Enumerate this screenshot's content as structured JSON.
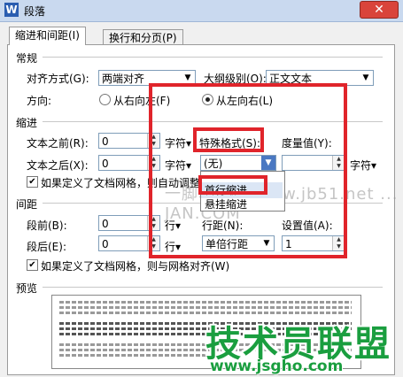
{
  "window": {
    "title": "段落",
    "app_icon": "W",
    "close_glyph": "✕"
  },
  "tabs": [
    {
      "label": "缩进和间距(I)",
      "active": true
    },
    {
      "label": "换行和分页(P)",
      "active": false
    }
  ],
  "general": {
    "heading": "常规",
    "alignment_label": "对齐方式(G):",
    "alignment_value": "两端对齐",
    "outline_label": "大纲级别(O):",
    "outline_value": "正文文本",
    "direction_label": "方向:",
    "rtl_label": "从右向左(F)",
    "ltr_label": "从左向右(L)"
  },
  "indent": {
    "heading": "缩进",
    "before_label": "文本之前(R):",
    "before_value": "0",
    "before_unit": "字符▾",
    "after_label": "文本之后(X):",
    "after_value": "0",
    "after_unit": "字符▾",
    "special_label": "特殊格式(S):",
    "special_value": "(无)",
    "measure_label": "度量值(Y):",
    "measure_value": "",
    "measure_unit": "字符▾",
    "grid_check_label": "如果定义了文档网格，则自动调整右缩进(D)",
    "dropdown_options": [
      "首行缩进",
      "悬挂缩进"
    ]
  },
  "spacing": {
    "heading": "间距",
    "before_label": "段前(B):",
    "before_value": "0",
    "before_unit": "行▾",
    "after_label": "段后(E):",
    "after_value": "0",
    "after_unit": "行▾",
    "line_label": "行距(N):",
    "line_value": "单倍行距",
    "setting_label": "设置值(A):",
    "setting_value": "1",
    "grid_check_label": "如果定义了文档网格，则与网格对齐(W)"
  },
  "preview": {
    "heading": "预览"
  },
  "watermark": {
    "text": "一脚本之家 www.jb51.net ... JAN.COM"
  },
  "branding": {
    "logo_text": "技术员联盟",
    "url": "www.jsgho.com"
  },
  "colors": {
    "highlight_red": "#e0242b",
    "logo_green": "#1a9e3f"
  }
}
